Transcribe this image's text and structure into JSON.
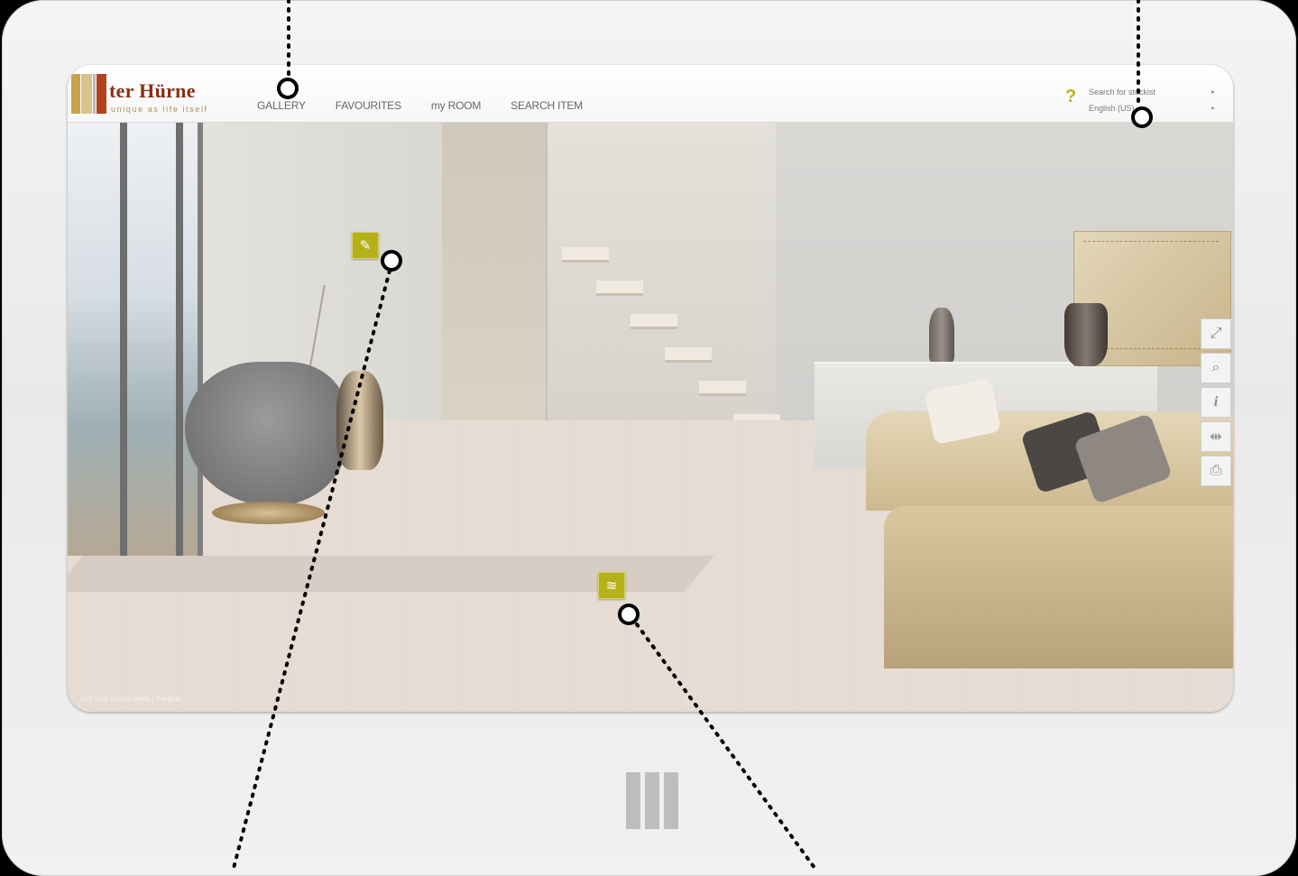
{
  "brand": {
    "name": "ter Hürne",
    "tagline": "unique as life itself",
    "colors": {
      "accent": "#b5b11a",
      "brand_red": "#8a2f14"
    }
  },
  "nav": {
    "items": [
      {
        "label": "GALLERY"
      },
      {
        "label": "FAVOURITES"
      },
      {
        "label": "my ROOM"
      },
      {
        "label": "SEARCH ITEM"
      }
    ]
  },
  "utility": {
    "help_icon": "question-mark-icon",
    "search_stockist": "Search for stockist",
    "language": "English (US)",
    "arrow_icon": "triangle-right-icon"
  },
  "scene": {
    "caption": "A91  Oak crystal white | Parquet"
  },
  "tools": [
    {
      "icon": "fullscreen-icon",
      "glyph": "⤢"
    },
    {
      "icon": "zoom-icon",
      "glyph": "⌕"
    },
    {
      "icon": "info-icon",
      "glyph": "i"
    },
    {
      "icon": "compare-icon",
      "glyph": "⇹"
    },
    {
      "icon": "print-icon",
      "glyph": "⎙"
    }
  ],
  "hotspots": [
    {
      "icon": "paintbrush-icon",
      "glyph": "✎"
    },
    {
      "icon": "layers-icon",
      "glyph": "≋"
    }
  ],
  "home_button_icon": "home-bars-icon"
}
